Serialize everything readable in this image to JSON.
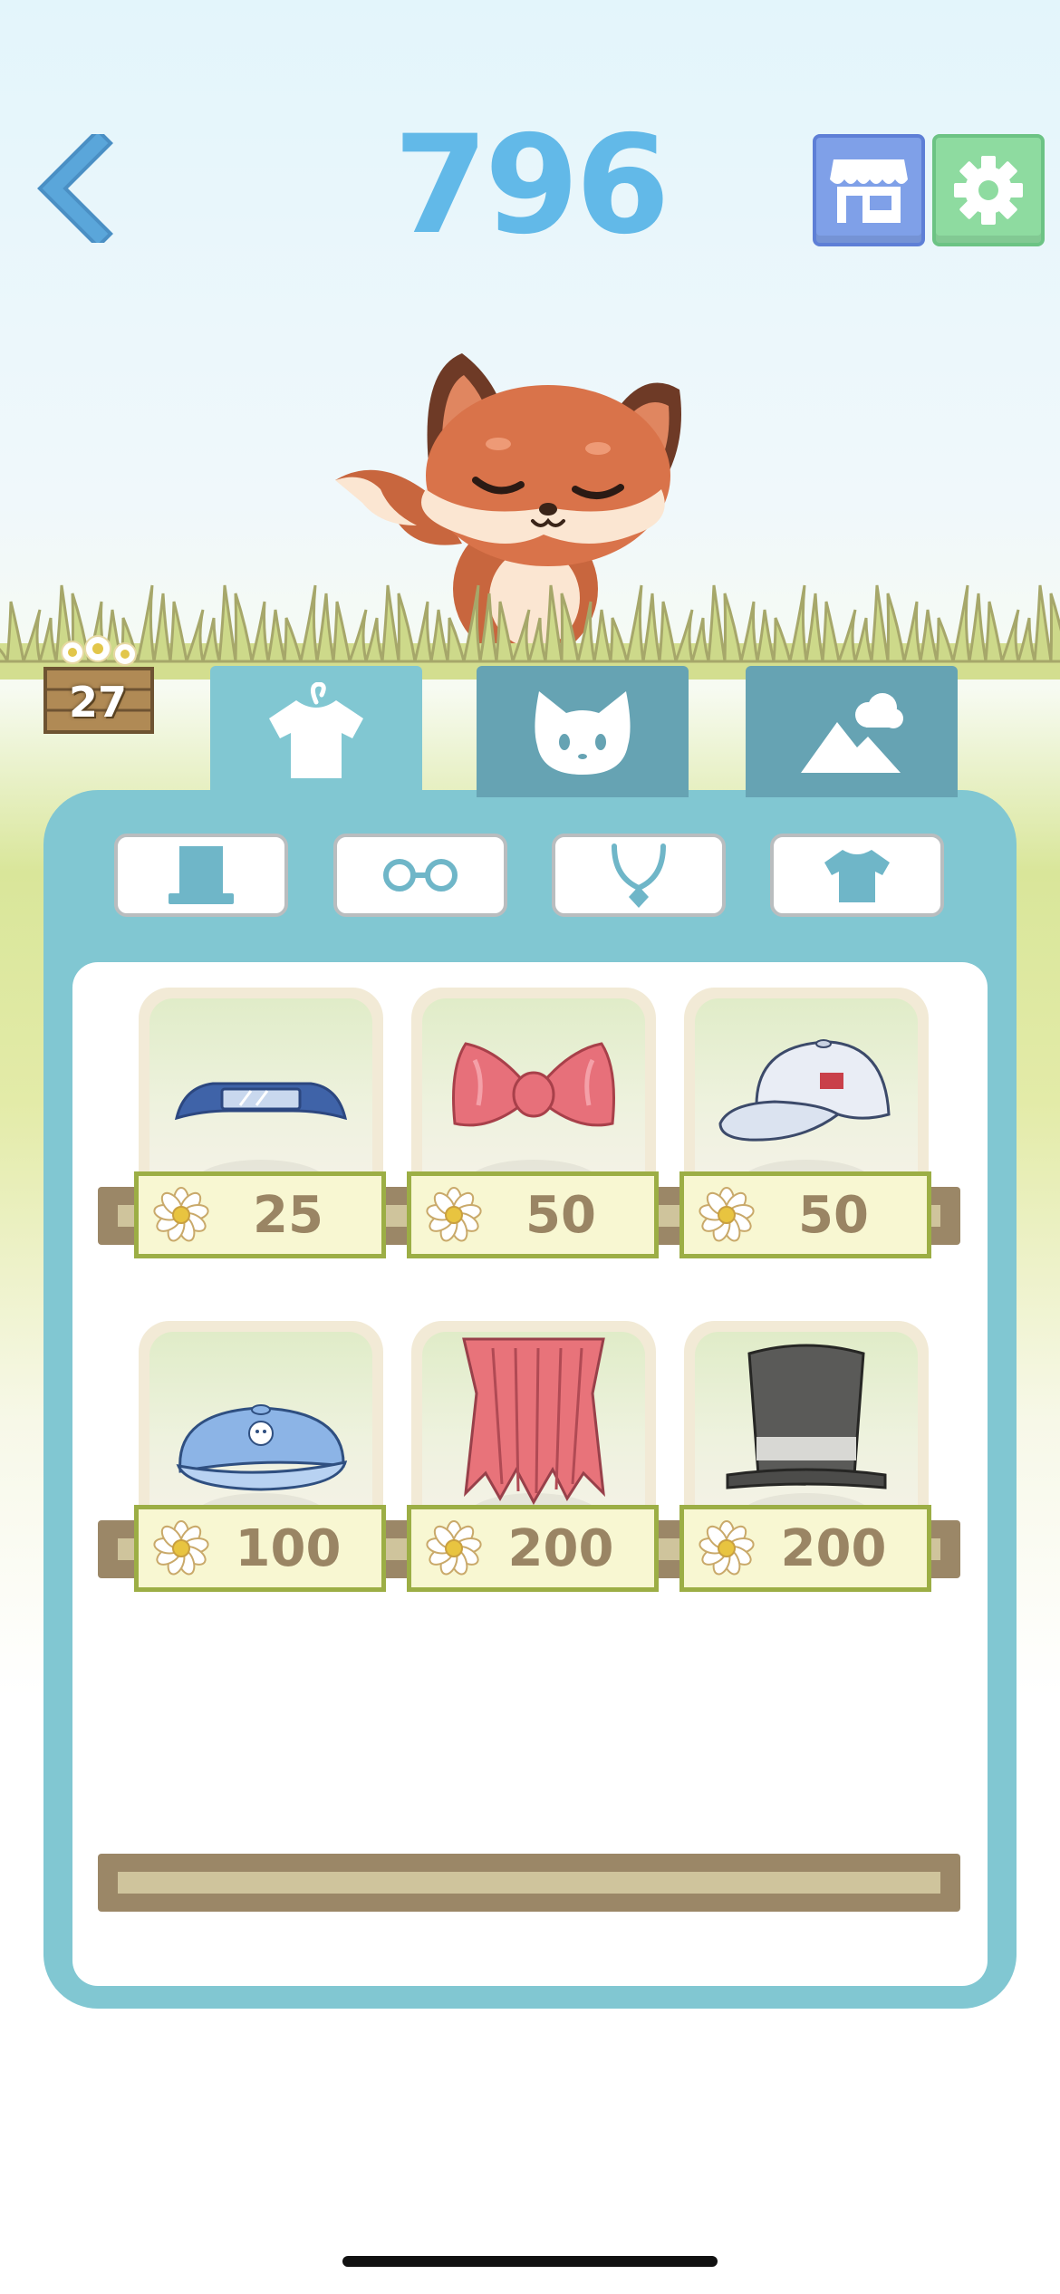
{
  "header": {
    "score": "796",
    "back_icon": "chevron-left-icon",
    "shop_icon": "storefront-icon",
    "settings_icon": "gear-icon"
  },
  "flower_counter": {
    "count": "27",
    "icon": "daisy-crate-icon"
  },
  "main_tabs": [
    {
      "id": "clothes",
      "icon": "t-shirt-hanger-icon",
      "active": true
    },
    {
      "id": "character",
      "icon": "cat-face-icon",
      "active": false
    },
    {
      "id": "scene",
      "icon": "mountain-cloud-icon",
      "active": false
    }
  ],
  "sub_tabs": [
    {
      "id": "hats",
      "icon": "top-hat-icon"
    },
    {
      "id": "glasses",
      "icon": "glasses-icon"
    },
    {
      "id": "necklace",
      "icon": "necklace-icon"
    },
    {
      "id": "shirts",
      "icon": "t-shirt-icon"
    }
  ],
  "items": [
    {
      "name": "visor",
      "price": "25"
    },
    {
      "name": "bow",
      "price": "50"
    },
    {
      "name": "white-cap",
      "price": "50"
    },
    {
      "name": "blue-cap",
      "price": "100"
    },
    {
      "name": "grass-skirt",
      "price": "200"
    },
    {
      "name": "top-hat",
      "price": "200"
    }
  ],
  "colors": {
    "score": "#62b9e8",
    "panel": "#81c7d2",
    "active_tab": "#81c7d2",
    "inactive_tab": "#66a3b3",
    "shop_button": "#7fa0e8",
    "settings_button": "#8edba0",
    "price_tag_border": "#9cae45",
    "price_text": "#9a8564"
  }
}
